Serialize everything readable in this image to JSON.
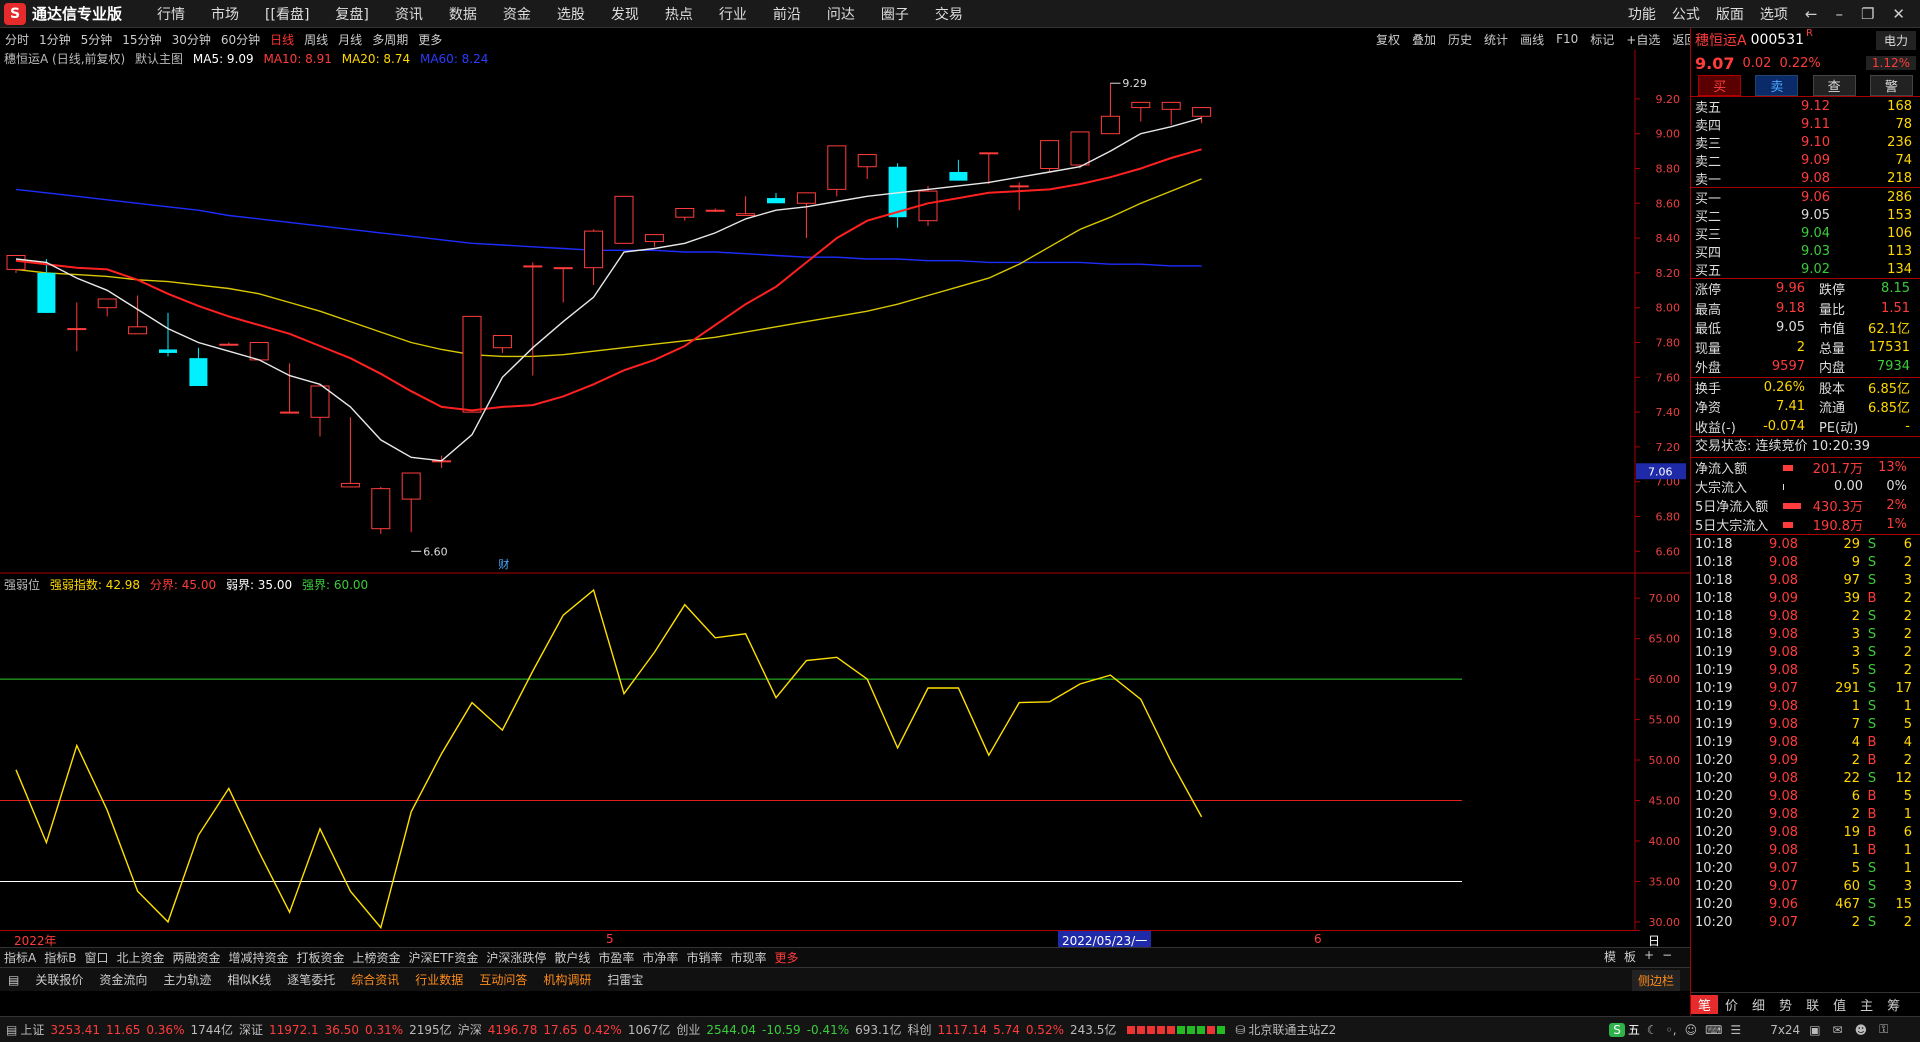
{
  "app": {
    "name": "通达信专业版",
    "menu": [
      "行情",
      "市场",
      "[[看盘]",
      "复盘]",
      "资讯",
      "数据",
      "资金",
      "选股",
      "发现",
      "热点",
      "行业",
      "前沿",
      "问达",
      "圈子",
      "交易"
    ],
    "right_menu": [
      "功能",
      "公式",
      "版面",
      "选项"
    ]
  },
  "periods": {
    "items": [
      "分时",
      "1分钟",
      "5分钟",
      "15分钟",
      "30分钟",
      "60分钟",
      "日线",
      "周线",
      "月线",
      "多周期",
      "更多"
    ],
    "active": "日线"
  },
  "tools": [
    "复权",
    "叠加",
    "历史",
    "统计",
    "画线",
    "F10",
    "标记",
    "+自选",
    "返回"
  ],
  "legend": {
    "name": "穗恒运A (日线,前复权)",
    "mode": "默认主图",
    "ma5": "MA5: 9.09",
    "ma10": "MA10: 8.91",
    "ma20": "MA20: 8.74",
    "ma60": "MA60: 8.24"
  },
  "indicator": {
    "name": "强弱位",
    "idx": "强弱指数: 42.98",
    "div": "分界: 45.00",
    "weak": "弱界: 35.00",
    "strong": "强界: 60.00"
  },
  "price_axis": [
    "9.20",
    "9.00",
    "8.80",
    "8.60",
    "8.40",
    "8.20",
    "8.00",
    "7.80",
    "7.60",
    "7.40",
    "7.20",
    "7.00",
    "6.80",
    "6.60"
  ],
  "price_marker": "7.06",
  "ind_axis": [
    "70.00",
    "65.00",
    "60.00",
    "55.00",
    "50.00",
    "45.00",
    "40.00",
    "35.00",
    "30.00"
  ],
  "annot": {
    "high": "9.29",
    "low": "6.60",
    "cai": "财"
  },
  "dates": {
    "year": "2022年",
    "m5": "5",
    "cursor": "2022/05/23/一",
    "m6": "6",
    "period": "日线"
  },
  "chart_data": {
    "type": "candlestick",
    "candles": [
      [
        8.22,
        8.3,
        8.2,
        8.3
      ],
      [
        8.2,
        8.28,
        8.16,
        7.97
      ],
      [
        7.88,
        8.03,
        7.75,
        7.88
      ],
      [
        8.0,
        8.04,
        7.95,
        8.05
      ],
      [
        7.85,
        8.07,
        7.85,
        7.89
      ],
      [
        7.76,
        7.97,
        7.72,
        7.74
      ],
      [
        7.71,
        7.77,
        7.63,
        7.55
      ],
      [
        7.79,
        7.79,
        7.8,
        7.79
      ],
      [
        7.7,
        7.71,
        7.7,
        7.8
      ],
      [
        7.4,
        7.68,
        7.58,
        7.4
      ],
      [
        7.37,
        7.56,
        7.26,
        7.55
      ],
      [
        6.97,
        7.37,
        7.34,
        6.99
      ],
      [
        6.73,
        6.97,
        6.7,
        6.96
      ],
      [
        6.9,
        6.96,
        6.71,
        7.05
      ],
      [
        7.12,
        7.15,
        7.08,
        7.12
      ],
      [
        7.4,
        7.86,
        7.72,
        7.95
      ],
      [
        7.77,
        7.84,
        7.74,
        7.84
      ],
      [
        8.24,
        7.61,
        8.26,
        8.24
      ],
      [
        8.23,
        8.2,
        8.03,
        8.23
      ],
      [
        8.23,
        8.45,
        8.13,
        8.44
      ],
      [
        8.37,
        8.43,
        8.4,
        8.64
      ],
      [
        8.38,
        8.42,
        8.35,
        8.42
      ],
      [
        8.52,
        8.57,
        8.5,
        8.57
      ],
      [
        8.56,
        8.57,
        8.55,
        8.56
      ],
      [
        8.53,
        8.64,
        8.55,
        8.54
      ],
      [
        8.63,
        8.66,
        8.61,
        8.6
      ],
      [
        8.6,
        8.66,
        8.4,
        8.66
      ],
      [
        8.68,
        8.88,
        8.64,
        8.93
      ],
      [
        8.81,
        8.82,
        8.74,
        8.88
      ],
      [
        8.81,
        8.83,
        8.46,
        8.52
      ],
      [
        8.5,
        8.7,
        8.47,
        8.67
      ],
      [
        8.78,
        8.77,
        8.85,
        8.73
      ],
      [
        8.89,
        8.71,
        8.71,
        8.89
      ],
      [
        8.7,
        8.72,
        8.56,
        8.7
      ],
      [
        8.8,
        8.86,
        8.78,
        8.96
      ],
      [
        8.82,
        9.01,
        8.8,
        9.01
      ],
      [
        9.0,
        9.24,
        9.29,
        9.1
      ],
      [
        9.15,
        9.1,
        9.07,
        9.18
      ],
      [
        9.14,
        9.08,
        9.05,
        9.18
      ],
      [
        9.1,
        9.06,
        9.07,
        9.15
      ]
    ],
    "ma5": [
      8.28,
      8.26,
      8.17,
      8.1,
      7.99,
      7.88,
      7.8,
      7.75,
      7.7,
      7.61,
      7.56,
      7.43,
      7.24,
      7.14,
      7.12,
      7.27,
      7.6,
      7.77,
      7.92,
      8.06,
      8.32,
      8.34,
      8.37,
      8.43,
      8.51,
      8.56,
      8.58,
      8.61,
      8.64,
      8.66,
      8.68,
      8.7,
      8.72,
      8.75,
      8.78,
      8.81,
      8.9,
      9.0,
      9.04,
      9.09
    ],
    "ma10": [
      8.27,
      8.25,
      8.23,
      8.22,
      8.16,
      8.08,
      8.01,
      7.95,
      7.9,
      7.85,
      7.78,
      7.71,
      7.62,
      7.52,
      7.43,
      7.41,
      7.43,
      7.44,
      7.49,
      7.56,
      7.64,
      7.7,
      7.78,
      7.9,
      8.02,
      8.12,
      8.26,
      8.4,
      8.5,
      8.55,
      8.6,
      8.63,
      8.66,
      8.67,
      8.68,
      8.71,
      8.75,
      8.8,
      8.86,
      8.91
    ],
    "ma20": [
      8.22,
      8.2,
      8.19,
      8.18,
      8.16,
      8.15,
      8.13,
      8.11,
      8.08,
      8.03,
      7.98,
      7.92,
      7.86,
      7.8,
      7.76,
      7.73,
      7.72,
      7.72,
      7.73,
      7.75,
      7.77,
      7.79,
      7.81,
      7.83,
      7.86,
      7.89,
      7.92,
      7.95,
      7.98,
      8.02,
      8.07,
      8.12,
      8.17,
      8.25,
      8.35,
      8.45,
      8.52,
      8.6,
      8.67,
      8.74
    ],
    "ma60": [
      8.68,
      8.66,
      8.64,
      8.62,
      8.6,
      8.58,
      8.56,
      8.53,
      8.51,
      8.49,
      8.47,
      8.45,
      8.43,
      8.41,
      8.39,
      8.37,
      8.36,
      8.35,
      8.34,
      8.33,
      8.33,
      8.33,
      8.32,
      8.32,
      8.31,
      8.3,
      8.29,
      8.29,
      8.28,
      8.28,
      8.27,
      8.27,
      8.26,
      8.26,
      8.26,
      8.26,
      8.25,
      8.25,
      8.24,
      8.24
    ],
    "strength": [
      48.8,
      39.8,
      51.8,
      43.8,
      33.8,
      30.0,
      40.7,
      46.5,
      38.6,
      31.2,
      41.5,
      33.8,
      29.3,
      43.6,
      50.8,
      57.1,
      53.7,
      61.0,
      67.9,
      71.0,
      58.2,
      63.3,
      69.2,
      65.1,
      65.6,
      57.7,
      62.3,
      62.7,
      60.0,
      51.5,
      58.9,
      58.9,
      50.6,
      57.1,
      57.2,
      59.4,
      60.5,
      57.5,
      49.8,
      42.98
    ],
    "levels": {
      "strong": 60,
      "divide": 45,
      "weak": 35
    },
    "ylim_price": [
      6.55,
      9.32
    ],
    "ylim_ind": [
      29,
      72
    ]
  },
  "quote": {
    "name": "穗恒运A",
    "code": "000531",
    "flag": "R",
    "sector": "电力",
    "price": "9.07",
    "chg": "0.02",
    "pct": "0.22%",
    "pct2": "1.12%",
    "btns": [
      "买",
      "卖",
      "查",
      "警"
    ],
    "asks": [
      [
        "卖五",
        "9.12",
        "168"
      ],
      [
        "卖四",
        "9.11",
        "78"
      ],
      [
        "卖三",
        "9.10",
        "236"
      ],
      [
        "卖二",
        "9.09",
        "74"
      ],
      [
        "卖一",
        "9.08",
        "218"
      ]
    ],
    "bids": [
      [
        "买一",
        "9.06",
        "286"
      ],
      [
        "买二",
        "9.05",
        "153"
      ],
      [
        "买三",
        "9.04",
        "106"
      ],
      [
        "买四",
        "9.03",
        "113"
      ],
      [
        "买五",
        "9.02",
        "134"
      ]
    ],
    "info": [
      [
        "涨停",
        "9.96",
        "跌停",
        "8.15"
      ],
      [
        "最高",
        "9.18",
        "量比",
        "1.51"
      ],
      [
        "最低",
        "9.05",
        "市值",
        "62.1亿"
      ],
      [
        "现量",
        "2",
        "总量",
        "17531"
      ],
      [
        "外盘",
        "9597",
        "内盘",
        "7934"
      ]
    ],
    "info2": [
      [
        "换手",
        "0.26%",
        "股本",
        "6.85亿"
      ],
      [
        "净资",
        "7.41",
        "流通",
        "6.85亿"
      ],
      [
        "收益(-)",
        "-0.074",
        "PE(动)",
        "-"
      ]
    ],
    "state": "交易状态: 连续竞价 10:20:39",
    "flows": [
      [
        "净流入额",
        "201.7万",
        "13%"
      ],
      [
        "大宗流入",
        "0.00",
        "0%"
      ],
      [
        "5日净流入额",
        "430.3万",
        "2%"
      ],
      [
        "5日大宗流入",
        "190.8万",
        "1%"
      ]
    ],
    "ticks": [
      [
        "10:18",
        "9.08",
        "29",
        "S",
        "6"
      ],
      [
        "10:18",
        "9.08",
        "9",
        "S",
        "2"
      ],
      [
        "10:18",
        "9.08",
        "97",
        "S",
        "3"
      ],
      [
        "10:18",
        "9.09",
        "39",
        "B",
        "2"
      ],
      [
        "10:18",
        "9.08",
        "2",
        "S",
        "2"
      ],
      [
        "10:18",
        "9.08",
        "3",
        "S",
        "2"
      ],
      [
        "10:19",
        "9.08",
        "3",
        "S",
        "2"
      ],
      [
        "10:19",
        "9.08",
        "5",
        "S",
        "2"
      ],
      [
        "10:19",
        "9.07",
        "291",
        "S",
        "17"
      ],
      [
        "10:19",
        "9.08",
        "1",
        "S",
        "1"
      ],
      [
        "10:19",
        "9.08",
        "7",
        "S",
        "5"
      ],
      [
        "10:19",
        "9.08",
        "4",
        "B",
        "4"
      ],
      [
        "10:20",
        "9.09",
        "2",
        "B",
        "2"
      ],
      [
        "10:20",
        "9.08",
        "22",
        "S",
        "12"
      ],
      [
        "10:20",
        "9.08",
        "6",
        "B",
        "5"
      ],
      [
        "10:20",
        "9.08",
        "2",
        "B",
        "1"
      ],
      [
        "10:20",
        "9.08",
        "19",
        "B",
        "6"
      ],
      [
        "10:20",
        "9.08",
        "1",
        "B",
        "1"
      ],
      [
        "10:20",
        "9.07",
        "5",
        "S",
        "1"
      ],
      [
        "10:20",
        "9.07",
        "60",
        "S",
        "3"
      ],
      [
        "10:20",
        "9.06",
        "467",
        "S",
        "15"
      ],
      [
        "10:20",
        "9.07",
        "2",
        "S",
        "2"
      ]
    ],
    "bottom_tabs": [
      "笔",
      "价",
      "细",
      "势",
      "联",
      "值",
      "主",
      "筹"
    ]
  },
  "tabs": [
    "指标A",
    "指标B",
    "窗口",
    "北上资金",
    "两融资金",
    "增减持资金",
    "打板资金",
    "上榜资金",
    "沪深ETF资金",
    "沪深涨跌停",
    "散户线",
    "市盈率",
    "市净率",
    "市销率",
    "市现率",
    "更多"
  ],
  "tabs_right": [
    "模",
    "板",
    "+",
    "−"
  ],
  "bottom_tabs": [
    "关联报价",
    "资金流向",
    "主力轨迹",
    "相似K线",
    "逐笔委托",
    "综合资讯",
    "行业数据",
    "互动问答",
    "机构调研",
    "扫雷宝"
  ],
  "bottom_right": "侧边栏",
  "status": {
    "sh": [
      "上证",
      "3253.41",
      "11.65",
      "0.36%",
      "1744亿"
    ],
    "sz": [
      "深证",
      "11972.1",
      "36.50",
      "0.31%",
      "2195亿"
    ],
    "hs": [
      "沪深",
      "4196.78",
      "17.65",
      "0.42%",
      "1067亿"
    ],
    "cy": [
      "创业",
      "2544.04",
      "-10.59",
      "-0.41%",
      "693.1亿"
    ],
    "kc": [
      "科创",
      "1117.14",
      "5.74",
      "0.52%",
      "243.5亿"
    ],
    "server": "北京联通主站Z2",
    "ime": "五",
    "mode": "7x24"
  }
}
